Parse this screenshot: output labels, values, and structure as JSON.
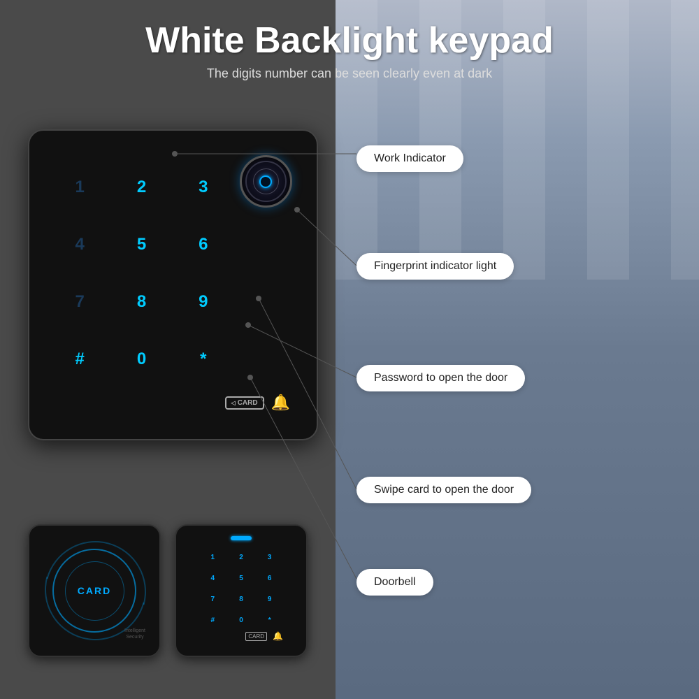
{
  "header": {
    "title": "White Backlight keypad",
    "subtitle": "The digits number can be seen clearly even at dark"
  },
  "annotations": {
    "work_indicator": "Work Indicator",
    "fingerprint_indicator": "Fingerprint indicator light",
    "password_door": "Password to open the door",
    "swipe_card": "Swipe card to open the door",
    "doorbell": "Doorbell"
  },
  "keypad": {
    "keys": [
      "1",
      "2",
      "3",
      "4",
      "5",
      "6",
      "7",
      "8",
      "9",
      "#",
      "0",
      "*"
    ],
    "special_keys": [
      "CARD",
      "BELL"
    ]
  },
  "card_device": {
    "text": "CARD",
    "subtitle1": "Intelligent",
    "subtitle2": "Security"
  }
}
